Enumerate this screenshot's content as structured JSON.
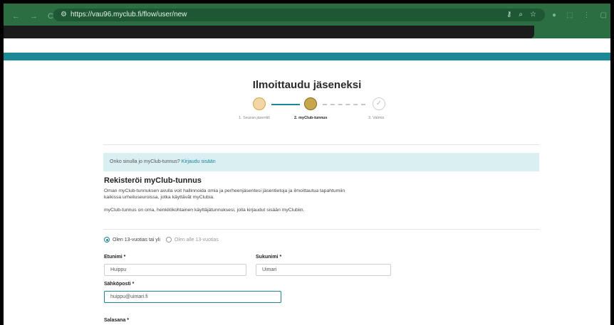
{
  "browser": {
    "url": "https://vau96.myclub.fi/flow/user/new",
    "nav_icons": [
      "←",
      "→",
      "C"
    ],
    "url_right_icons": [
      "⚷",
      "⌕",
      "☆"
    ],
    "ext_icons": [
      "●",
      "⬚",
      "⋮",
      "▢"
    ]
  },
  "page": {
    "title": "Ilmoittaudu jäseneksi"
  },
  "steps": [
    {
      "label": "1. Seuran jäsentili"
    },
    {
      "label": "2. myClub-tunnus"
    },
    {
      "label": "3. Valmis",
      "icon": "✓"
    }
  ],
  "login": {
    "question": "Onko sinulla jo myClub-tunnus?",
    "link": "Kirjaudu sisään"
  },
  "register": {
    "title": "Rekisteröi myClub-tunnus",
    "desc_line1": "Oman myClub-tunnuksen avulla voit hallinnoida omia ja perheenjäsentesi jäsentietoja ja ilmoittautua tapahtumiin",
    "desc_line2": "kaikissa urheiluseuroissa, jotka käyttävät myClubia.",
    "desc_line3": "myClub-tunnus on oma, henkilökohtainen käyttäjätunnuksesi, jolla kirjaudut sisään myClubiin."
  },
  "age": {
    "option1": "Olen 13-vuotias tai yli",
    "option2": "Olen alle 13-vuotias"
  },
  "form": {
    "firstname_label": "Etunimi *",
    "firstname_value": "Huippu",
    "lastname_label": "Sukunimi *",
    "lastname_value": "Uimari",
    "email_label": "Sähköposti *",
    "email_value": "huippu@uimari.fi",
    "password_label": "Salasana *"
  }
}
